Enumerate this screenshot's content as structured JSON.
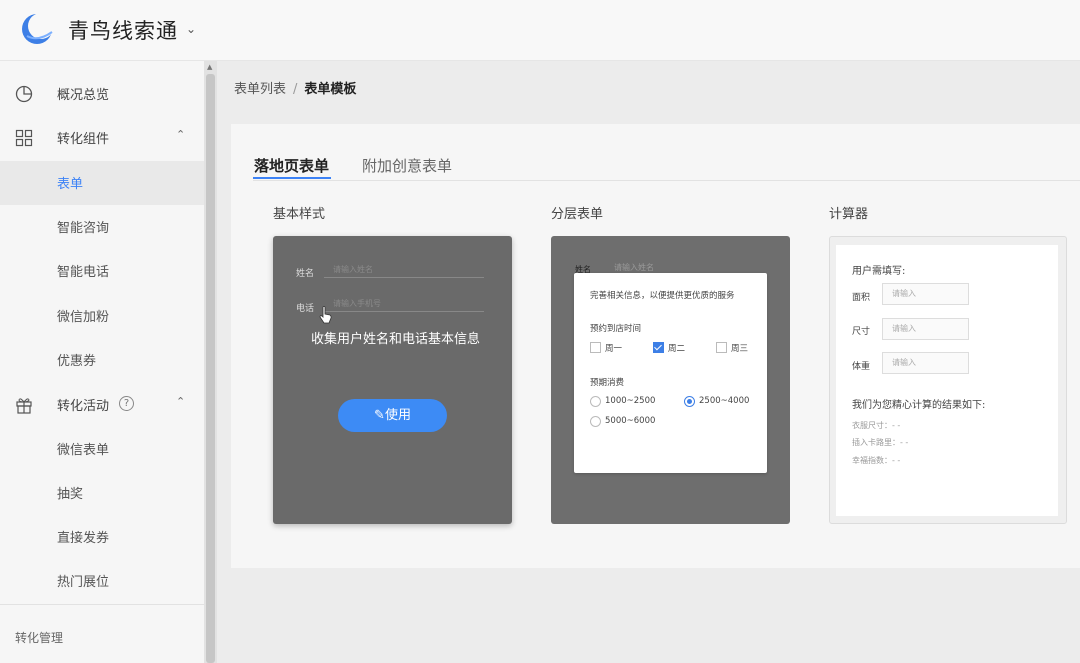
{
  "app": {
    "brand": "青鸟线索通"
  },
  "sidebar": {
    "items": [
      {
        "label": "概况总览",
        "icon": "pie-chart-icon"
      },
      {
        "label": "转化组件",
        "icon": "grid-icon"
      },
      {
        "label": "表单"
      },
      {
        "label": "智能咨询"
      },
      {
        "label": "智能电话"
      },
      {
        "label": "微信加粉"
      },
      {
        "label": "优惠券"
      },
      {
        "label": "转化活动",
        "icon": "gift-icon"
      },
      {
        "label": "微信表单"
      },
      {
        "label": "抽奖"
      },
      {
        "label": "直接发券"
      },
      {
        "label": "热门展位"
      }
    ],
    "footer": "转化管理"
  },
  "breadcrumb": {
    "parent": "表单列表",
    "separator": "/",
    "current": "表单模板"
  },
  "tabs": [
    {
      "label": "落地页表单",
      "active": true
    },
    {
      "label": "附加创意表单",
      "active": false
    }
  ],
  "templates": {
    "basic": {
      "title": "基本样式",
      "name_label": "姓名",
      "name_placeholder": "请输入姓名",
      "phone_label": "电话",
      "phone_placeholder": "请输入手机号",
      "description": "收集用户姓名和电话基本信息",
      "button": "✎使用"
    },
    "layered": {
      "title": "分层表单",
      "bg_label": "姓名",
      "bg_placeholder": "请输入姓名",
      "prompt": "完善相关信息，以便提供更优质的服务",
      "q1": "预约到店时间",
      "days": [
        "周一",
        "周二",
        "周三"
      ],
      "days_checked": [
        false,
        true,
        false
      ],
      "q2": "预期消费",
      "ranges": [
        "1000~2500",
        "2500~4000",
        "5000~6000"
      ],
      "range_selected": 1
    },
    "calculator": {
      "title": "计算器",
      "heading": "用户需填写:",
      "fields": [
        {
          "label": "面积",
          "placeholder": "请输入"
        },
        {
          "label": "尺寸",
          "placeholder": "请输入"
        },
        {
          "label": "体重",
          "placeholder": "请输入"
        }
      ],
      "result_heading": "我们为您精心计算的结果如下:",
      "results": [
        "衣服尺寸：- -",
        "插入卡路里：- -",
        "幸福指数：- -"
      ]
    }
  },
  "colors": {
    "accent": "#3c82f6"
  }
}
